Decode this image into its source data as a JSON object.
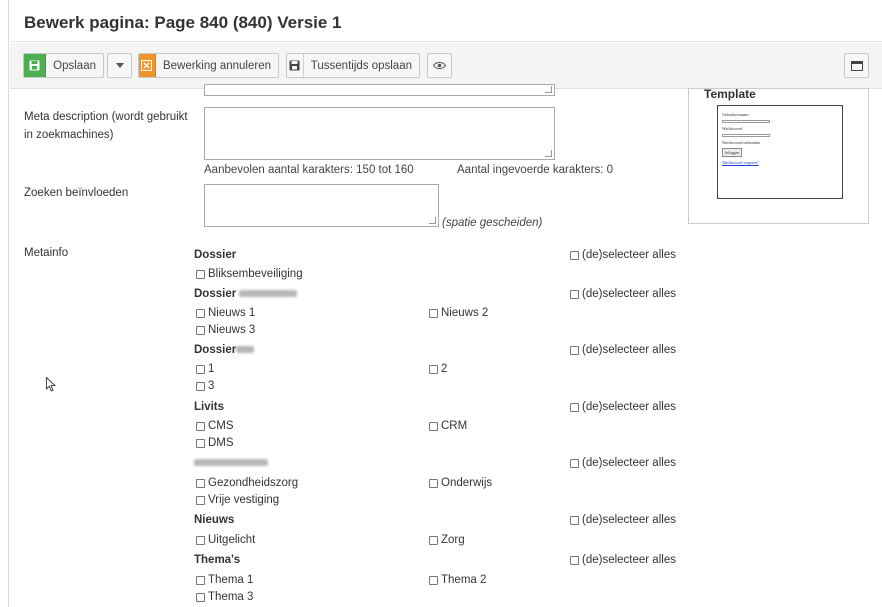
{
  "header": {
    "title": "Bewerk pagina: Page 840 (840) Versie 1"
  },
  "toolbar": {
    "save_label": "Opslaan",
    "cancel_label": "Bewerking annuleren",
    "interim_save_label": "Tussentijds opslaan",
    "colors": {
      "save": "#4caf50",
      "cancel": "#f0932b"
    }
  },
  "form": {
    "meta_description_label": "Meta description (wordt gebruikt in zoekmachines)",
    "recommended_chars": "Aanbevolen aantal karakters: 150 tot 160",
    "entered_chars": "Aantal ingevoerde karakters: 0",
    "search_influence_label": "Zoeken beïnvloeden",
    "space_separated_hint": "(spatie gescheiden)",
    "metainfo_label": "Metainfo"
  },
  "template": {
    "title": "Template"
  },
  "select_all_label": "(de)selecteer alles",
  "groups": [
    {
      "title": "Dossier",
      "items": [
        "Bliksembeveiliging"
      ]
    },
    {
      "title": "Dossier",
      "items": [
        "Nieuws 1",
        "Nieuws 2",
        "Nieuws 3"
      ]
    },
    {
      "title": "Dossier",
      "items": [
        "1",
        "2",
        "3"
      ]
    },
    {
      "title": "Livits",
      "items": [
        "CMS",
        "CRM",
        "DMS"
      ]
    },
    {
      "title": "",
      "items": [
        "Gezondheidszorg",
        "Onderwijs",
        "Vrije vestiging"
      ]
    },
    {
      "title": "Nieuws",
      "items": [
        "Uitgelicht",
        "Zorg"
      ]
    },
    {
      "title": "Thema's",
      "items": [
        "Thema 1",
        "Thema 2",
        "Thema 3"
      ]
    }
  ]
}
